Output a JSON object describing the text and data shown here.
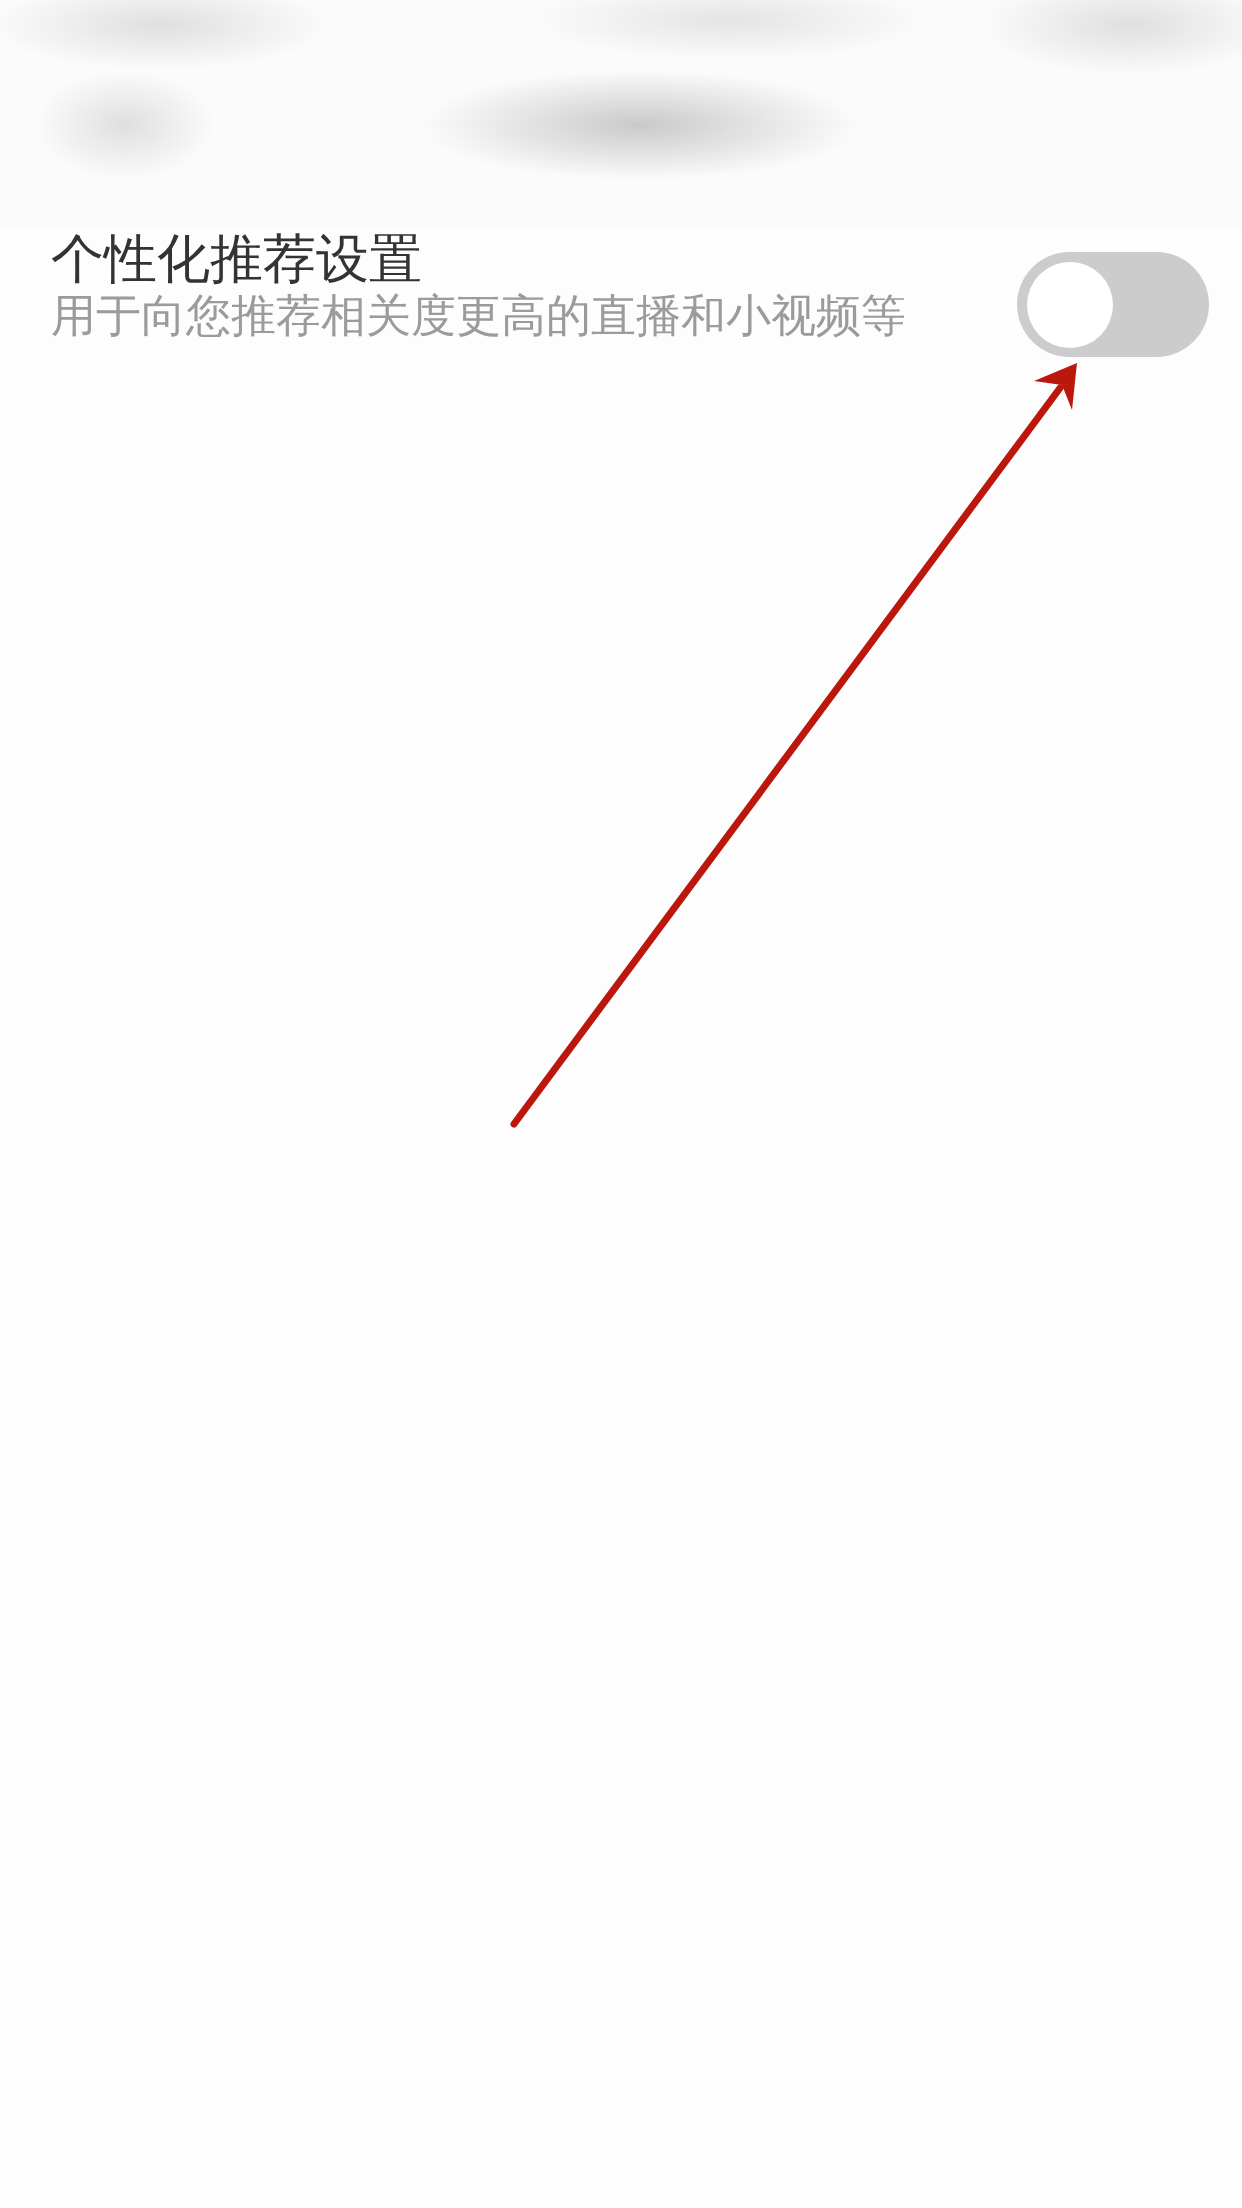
{
  "setting": {
    "title": "个性化推荐设置",
    "description": "用于向您推荐相关度更高的直播和小视频等",
    "on": false
  }
}
